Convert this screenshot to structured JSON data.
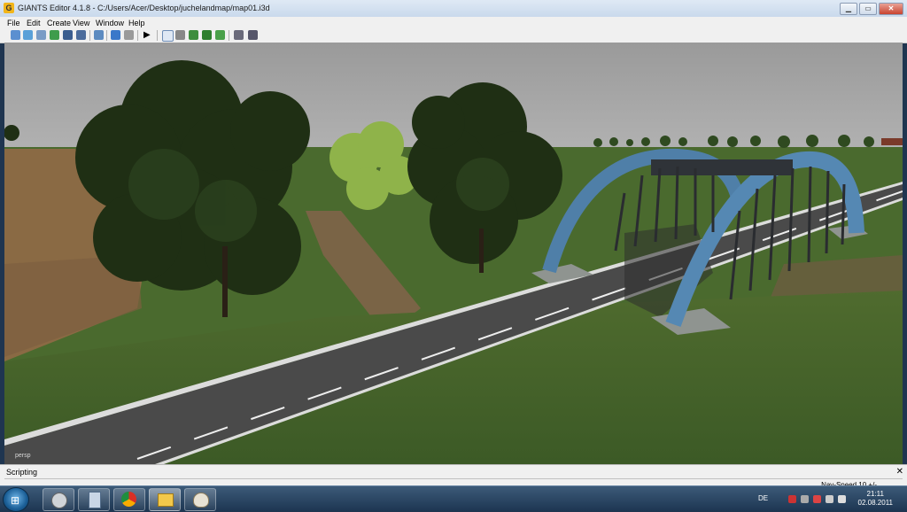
{
  "window": {
    "title": "GIANTS Editor 4.1.8 - C:/Users/Acer/Desktop/juchelandmap/map01.i3d",
    "buttons": {
      "minimize": "▁",
      "maximize": "▭",
      "close": "✕"
    }
  },
  "menu": [
    "File",
    "Edit",
    "Create",
    "View",
    "Window",
    "Help"
  ],
  "toolbar": {
    "icons": [
      "new-icon",
      "open-icon",
      "import-icon",
      "refresh-icon",
      "save-icon",
      "save-as-icon",
      "scene-icon",
      "undo-icon",
      "redo-icon",
      "play-icon",
      "select-icon",
      "move-icon",
      "terrain-icon",
      "paint-icon",
      "foliage-icon",
      "settings-icon",
      "gear-icon"
    ]
  },
  "viewport": {
    "camera_label": "persp"
  },
  "scripting": {
    "title": "Scripting",
    "nav_speed": "Nav-Speed 10 +/-",
    "close": "✕"
  },
  "taskbar": {
    "start_glyph": "⊞",
    "apps": [
      "giants-editor-icon",
      "calculator-icon",
      "chrome-icon",
      "file-manager-icon",
      "paint-icon"
    ],
    "tray": {
      "language": "DE",
      "time": "21:11",
      "date": "02.08.2011"
    }
  }
}
